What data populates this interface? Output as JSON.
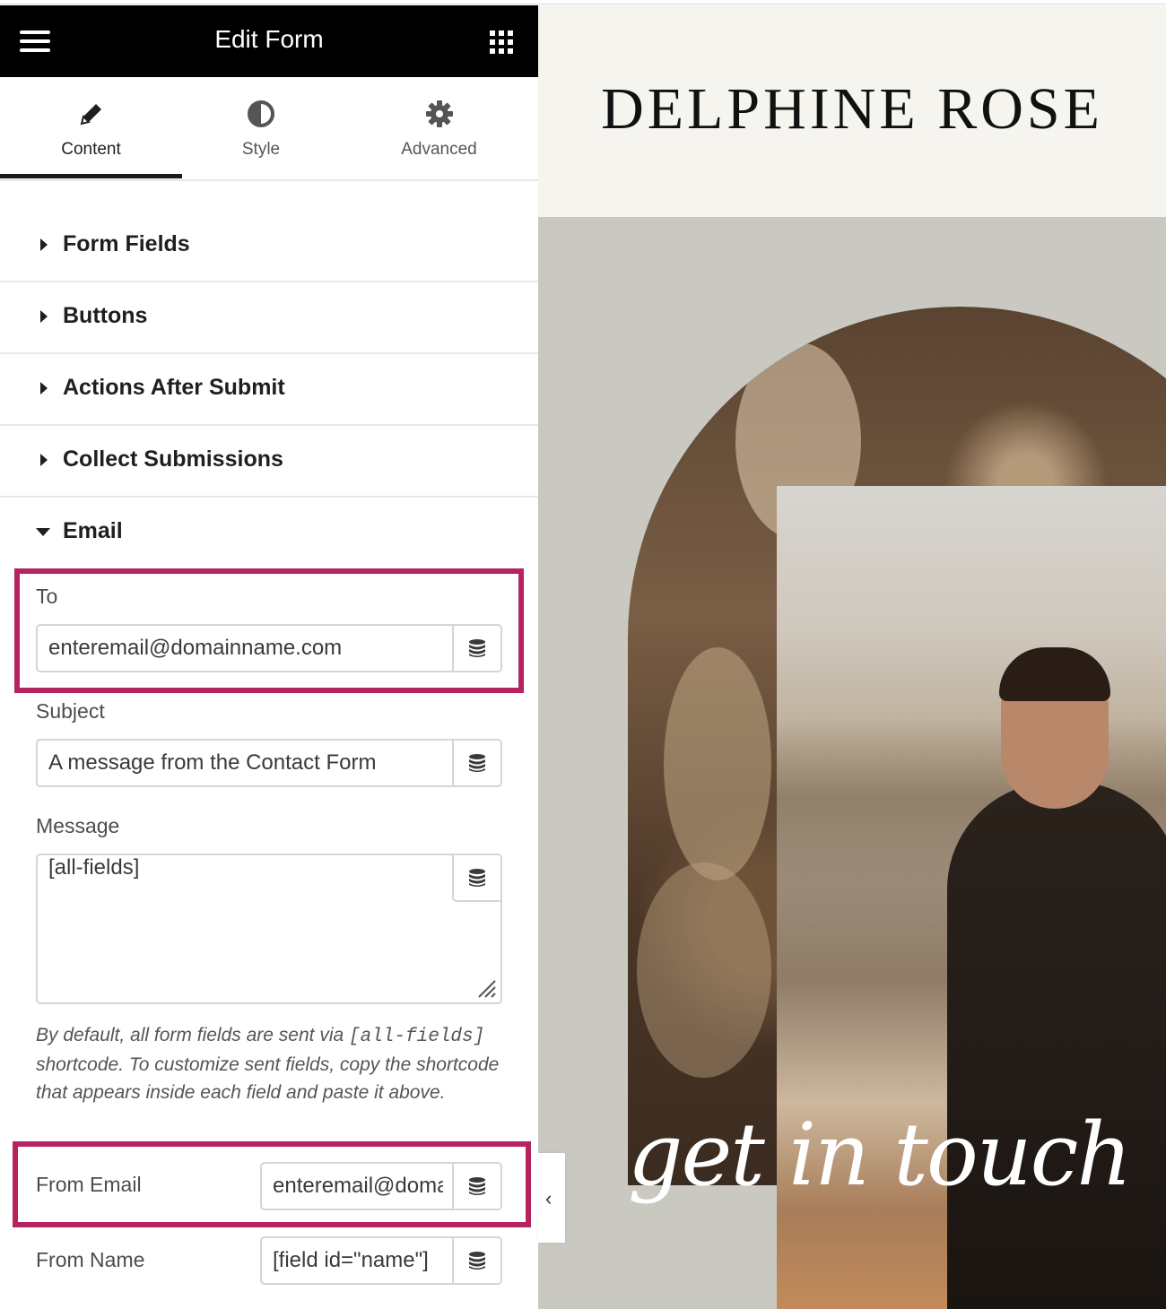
{
  "panel": {
    "title": "Edit Form",
    "tabs": [
      {
        "label": "Content",
        "icon": "pencil-icon",
        "active": true
      },
      {
        "label": "Style",
        "icon": "contrast-icon"
      },
      {
        "label": "Advanced",
        "icon": "gear-icon"
      }
    ],
    "sections": [
      {
        "label": "Form Fields",
        "expanded": false
      },
      {
        "label": "Buttons",
        "expanded": false
      },
      {
        "label": "Actions After Submit",
        "expanded": false
      },
      {
        "label": "Collect Submissions",
        "expanded": false
      },
      {
        "label": "Email",
        "expanded": true
      }
    ],
    "email": {
      "to_label": "To",
      "to_value": "enteremail@domainname.com",
      "subject_label": "Subject",
      "subject_value": "A message from the Contact Form",
      "message_label": "Message",
      "message_value": "[all-fields]",
      "help_pre": "By default, all form fields are sent via ",
      "help_code": "[all-fields]",
      "help_post": " shortcode. To customize sent fields, copy the shortcode that appears inside each field and paste it above.",
      "from_email_label": "From Email",
      "from_email_value": "enteremail@domainname.com",
      "from_name_label": "From Name",
      "from_name_value": "[field id=\"name\"]"
    },
    "highlight_color": "#b5245e"
  },
  "preview": {
    "brand": "DELPHINE ROSE",
    "script_text": "get in touch"
  }
}
